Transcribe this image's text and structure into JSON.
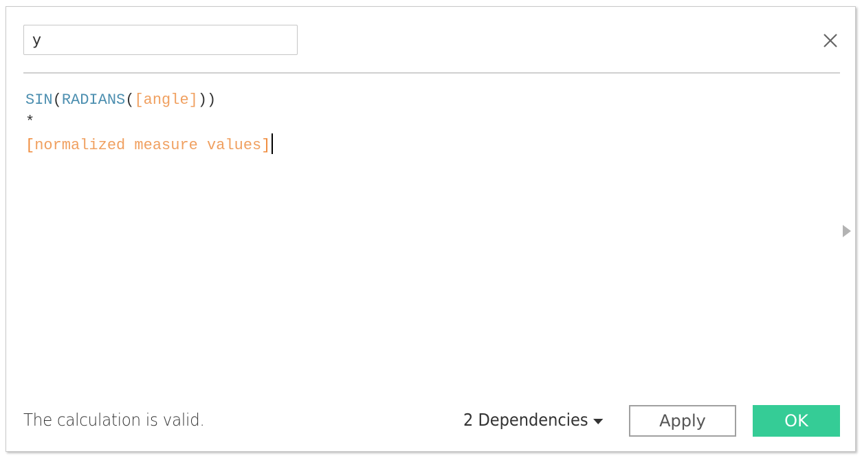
{
  "dialog": {
    "calc_name": "y",
    "close_icon": "close-icon",
    "expand_icon": "triangle-right-icon"
  },
  "formula": {
    "lines": [
      [
        {
          "type": "function",
          "text": "SIN"
        },
        {
          "type": "paren",
          "text": "("
        },
        {
          "type": "function",
          "text": "RADIANS"
        },
        {
          "type": "paren",
          "text": "("
        },
        {
          "type": "field",
          "text": "[angle]"
        },
        {
          "type": "paren",
          "text": "))"
        }
      ],
      [
        {
          "type": "operator",
          "text": "*"
        }
      ],
      [
        {
          "type": "field-bracket",
          "text": "["
        },
        {
          "type": "field",
          "text": "normalized measure values"
        },
        {
          "type": "field-bracket",
          "text": "]"
        }
      ]
    ]
  },
  "footer": {
    "status": "The calculation is valid.",
    "dependencies_label": "2 Dependencies",
    "dependencies_icon": "caret-down-icon",
    "apply_label": "Apply",
    "ok_label": "OK"
  },
  "colors": {
    "function": "#4d8fb0",
    "field": "#f0a060",
    "ok_button": "#35cc96"
  }
}
